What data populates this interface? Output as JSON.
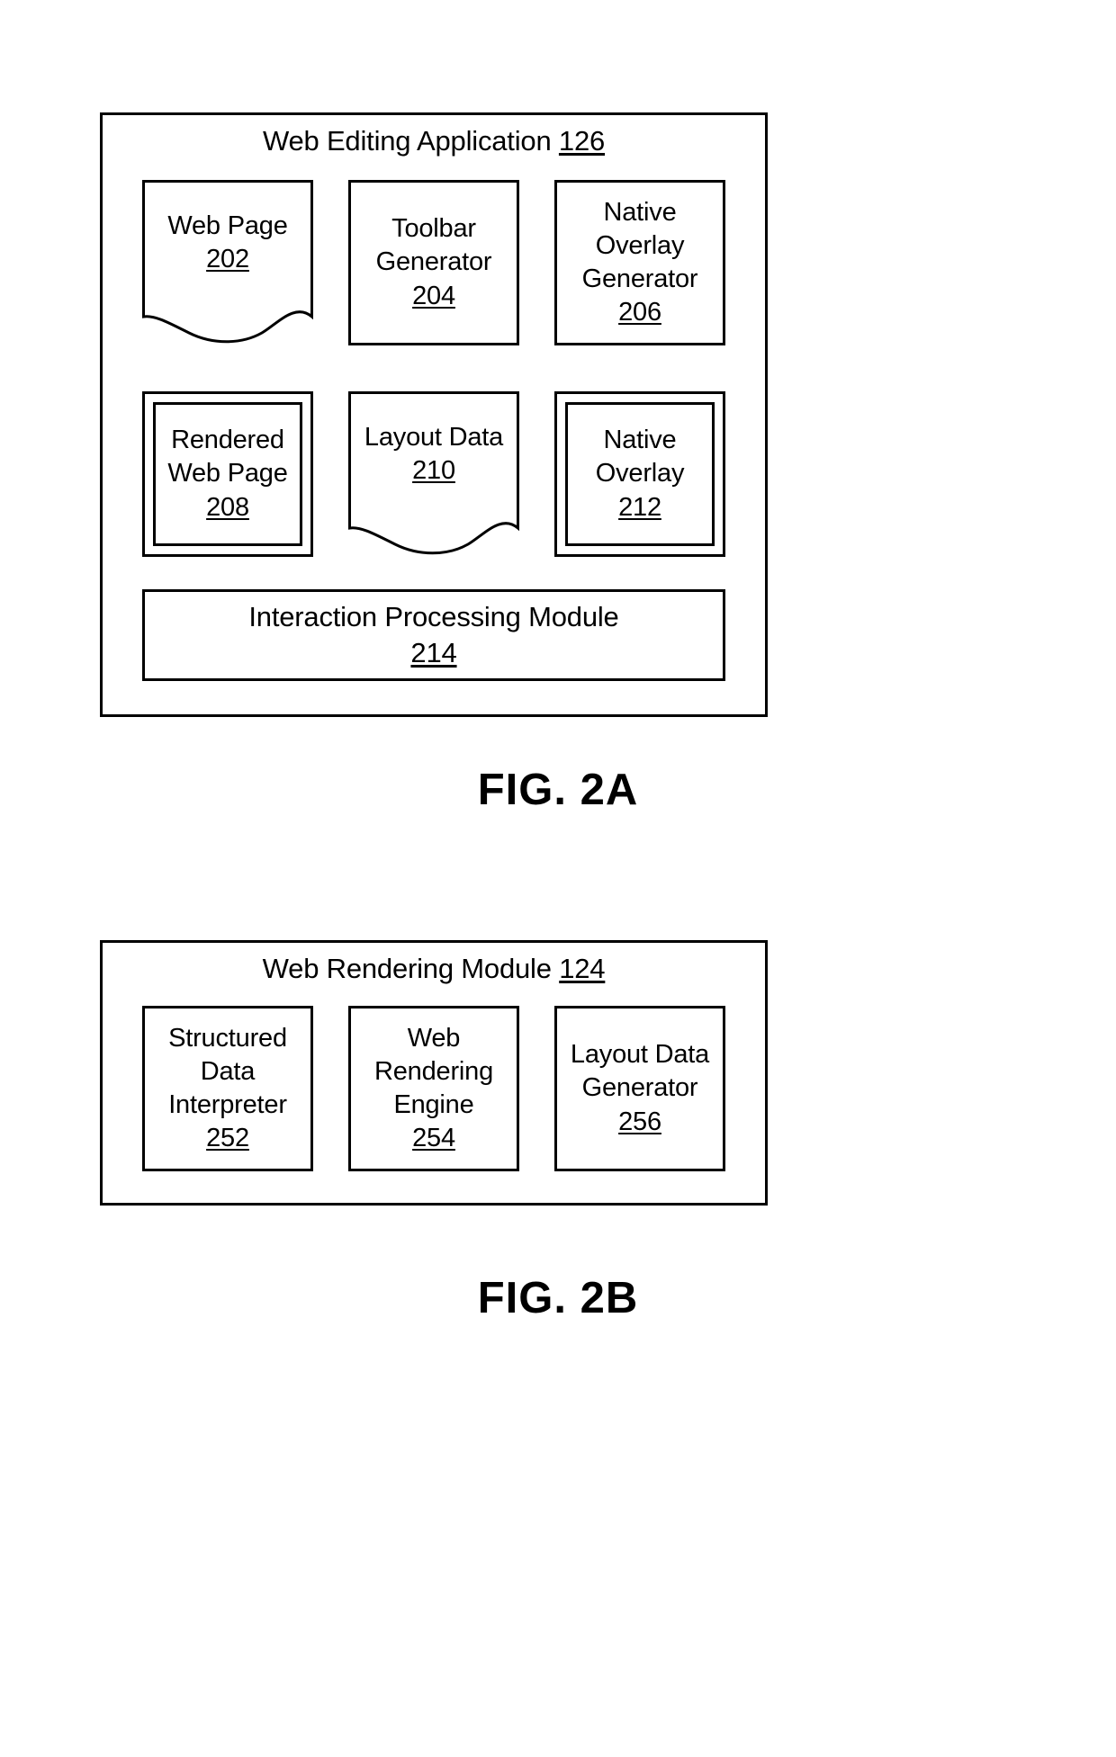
{
  "figures": [
    {
      "id": "2a",
      "caption": "FIG. 2A",
      "title": "Web Editing Application",
      "title_ref": "126",
      "rows": [
        {
          "cells": [
            {
              "name": "web-page",
              "shape": "doc",
              "label": "Web Page",
              "ref": "202"
            },
            {
              "name": "toolbar-generator",
              "shape": "plain",
              "label": "Toolbar\nGenerator",
              "ref": "204"
            },
            {
              "name": "native-overlay-generator",
              "shape": "plain",
              "label": "Native\nOverlay\nGenerator",
              "ref": "206"
            }
          ]
        },
        {
          "cells": [
            {
              "name": "rendered-web-page",
              "shape": "double",
              "label": "Rendered\nWeb Page",
              "ref": "208"
            },
            {
              "name": "layout-data",
              "shape": "doc",
              "label": "Layout Data",
              "ref": "210"
            },
            {
              "name": "native-overlay",
              "shape": "double",
              "label": "Native\nOverlay",
              "ref": "212"
            }
          ]
        },
        {
          "cells": [
            {
              "name": "interaction-processing-module",
              "shape": "plain-wide",
              "label": "Interaction Processing Module",
              "ref": "214"
            }
          ]
        }
      ]
    },
    {
      "id": "2b",
      "caption": "FIG. 2B",
      "title": "Web Rendering Module",
      "title_ref": "124",
      "rows": [
        {
          "cells": [
            {
              "name": "structured-data-interpreter",
              "shape": "plain",
              "label": "Structured\nData\nInterpreter",
              "ref": "252"
            },
            {
              "name": "web-rendering-engine",
              "shape": "plain",
              "label": "Web\nRendering\nEngine",
              "ref": "254"
            },
            {
              "name": "layout-data-generator",
              "shape": "plain",
              "label": "Layout Data\nGenerator",
              "ref": "256"
            }
          ]
        }
      ]
    }
  ],
  "fig2a": {
    "title": "Web Editing Application",
    "title_ref": "126",
    "caption": "FIG. 2A",
    "web_page": {
      "label": "Web Page",
      "ref": "202"
    },
    "toolbar_generator": {
      "line1": "Toolbar",
      "line2": "Generator",
      "ref": "204"
    },
    "native_overlay_generator": {
      "line1": "Native",
      "line2": "Overlay",
      "line3": "Generator",
      "ref": "206"
    },
    "rendered_web_page": {
      "line1": "Rendered",
      "line2": "Web Page",
      "ref": "208"
    },
    "layout_data": {
      "label": "Layout Data",
      "ref": "210"
    },
    "native_overlay": {
      "line1": "Native",
      "line2": "Overlay",
      "ref": "212"
    },
    "interaction_processing_module": {
      "label": "Interaction Processing Module",
      "ref": "214"
    }
  },
  "fig2b": {
    "title": "Web Rendering Module",
    "title_ref": "124",
    "caption": "FIG. 2B",
    "structured_data_interpreter": {
      "line1": "Structured",
      "line2": "Data",
      "line3": "Interpreter",
      "ref": "252"
    },
    "web_rendering_engine": {
      "line1": "Web",
      "line2": "Rendering",
      "line3": "Engine",
      "ref": "254"
    },
    "layout_data_generator": {
      "line1": "Layout Data",
      "line2": "Generator",
      "ref": "256"
    }
  },
  "colors": {
    "stroke": "#000000",
    "background": "#ffffff"
  }
}
